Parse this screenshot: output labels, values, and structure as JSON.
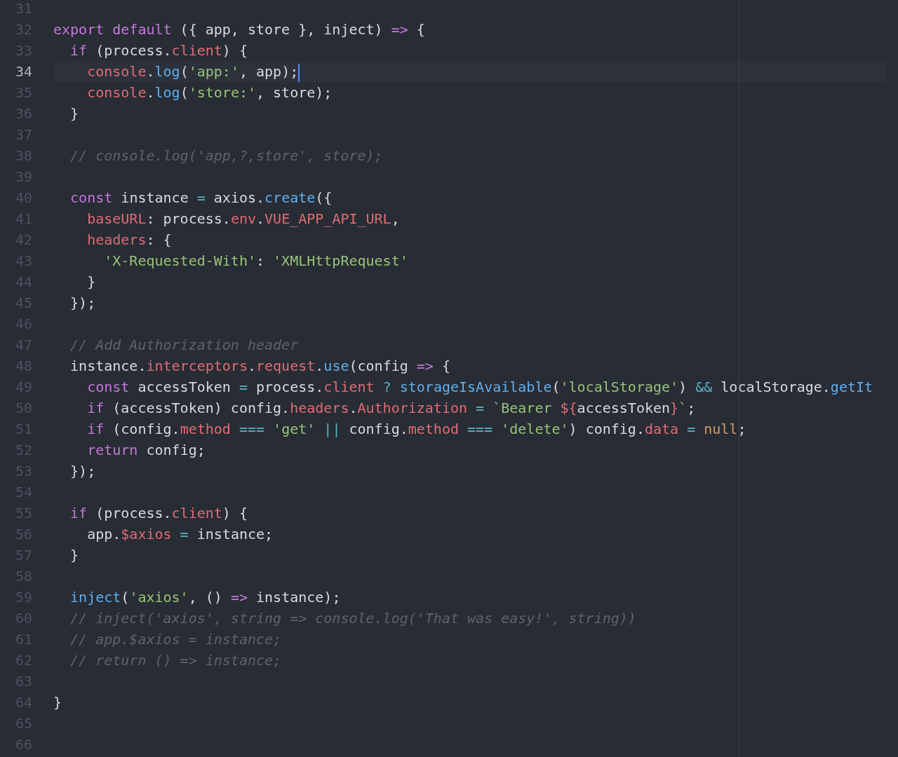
{
  "editor": {
    "lines": [
      {
        "number": "31",
        "active": false
      },
      {
        "number": "32",
        "active": false,
        "tokens": [
          {
            "kind": "keyword",
            "text": "export default"
          },
          {
            "kind": "plain",
            "text": " ({ app, store }, inject) "
          },
          {
            "kind": "keyword",
            "text": "=>"
          },
          {
            "kind": "plain",
            "text": " {"
          }
        ]
      },
      {
        "number": "33",
        "active": false,
        "tokens": [
          {
            "kind": "keyword",
            "text": "  if"
          },
          {
            "kind": "plain",
            "text": " (process."
          },
          {
            "kind": "property",
            "text": "client"
          },
          {
            "kind": "plain",
            "text": ") {"
          }
        ]
      },
      {
        "number": "34",
        "active": true,
        "tokens": [
          {
            "kind": "property",
            "text": "    console"
          },
          {
            "kind": "plain",
            "text": "."
          },
          {
            "kind": "function",
            "text": "log"
          },
          {
            "kind": "plain",
            "text": "("
          },
          {
            "kind": "string",
            "text": "'app:'"
          },
          {
            "kind": "plain",
            "text": ", app);"
          }
        ]
      },
      {
        "number": "35",
        "active": false,
        "tokens": [
          {
            "kind": "property",
            "text": "    console"
          },
          {
            "kind": "plain",
            "text": "."
          },
          {
            "kind": "function",
            "text": "log"
          },
          {
            "kind": "plain",
            "text": "("
          },
          {
            "kind": "string",
            "text": "'store:'"
          },
          {
            "kind": "plain",
            "text": ", store);"
          }
        ]
      },
      {
        "number": "36",
        "active": false,
        "tokens": [
          {
            "kind": "plain",
            "text": "  }"
          }
        ]
      },
      {
        "number": "37",
        "active": false
      },
      {
        "number": "38",
        "active": false,
        "tokens": [
          {
            "kind": "comment",
            "text": "  // console.log('app,?,store', store);"
          }
        ]
      },
      {
        "number": "39",
        "active": false
      },
      {
        "number": "40",
        "active": false,
        "tokens": [
          {
            "kind": "keyword",
            "text": "  const"
          },
          {
            "kind": "plain",
            "text": " instance "
          },
          {
            "kind": "operator",
            "text": "="
          },
          {
            "kind": "plain",
            "text": " axios."
          },
          {
            "kind": "function",
            "text": "create"
          },
          {
            "kind": "plain",
            "text": "({"
          }
        ]
      },
      {
        "number": "41",
        "active": false,
        "tokens": [
          {
            "kind": "property",
            "text": "    baseURL"
          },
          {
            "kind": "plain",
            "text": ": process."
          },
          {
            "kind": "property",
            "text": "env"
          },
          {
            "kind": "plain",
            "text": "."
          },
          {
            "kind": "property",
            "text": "VUE_APP_API_URL"
          },
          {
            "kind": "plain",
            "text": ","
          }
        ]
      },
      {
        "number": "42",
        "active": false,
        "tokens": [
          {
            "kind": "property",
            "text": "    headers"
          },
          {
            "kind": "plain",
            "text": ": {"
          }
        ]
      },
      {
        "number": "43",
        "active": false,
        "tokens": [
          {
            "kind": "string",
            "text": "      'X-Requested-With'"
          },
          {
            "kind": "plain",
            "text": ": "
          },
          {
            "kind": "string",
            "text": "'XMLHttpRequest'"
          }
        ]
      },
      {
        "number": "44",
        "active": false,
        "tokens": [
          {
            "kind": "plain",
            "text": "    }"
          }
        ]
      },
      {
        "number": "45",
        "active": false,
        "tokens": [
          {
            "kind": "plain",
            "text": "  });"
          }
        ]
      },
      {
        "number": "46",
        "active": false
      },
      {
        "number": "47",
        "active": false,
        "tokens": [
          {
            "kind": "comment",
            "text": "  // Add Authorization header"
          }
        ]
      },
      {
        "number": "48",
        "active": false,
        "tokens": [
          {
            "kind": "plain",
            "text": "  instance."
          },
          {
            "kind": "property",
            "text": "interceptors"
          },
          {
            "kind": "plain",
            "text": "."
          },
          {
            "kind": "property",
            "text": "request"
          },
          {
            "kind": "plain",
            "text": "."
          },
          {
            "kind": "function",
            "text": "use"
          },
          {
            "kind": "plain",
            "text": "(config "
          },
          {
            "kind": "keyword",
            "text": "=>"
          },
          {
            "kind": "plain",
            "text": " {"
          }
        ]
      },
      {
        "number": "49",
        "active": false,
        "tokens": [
          {
            "kind": "keyword",
            "text": "    const"
          },
          {
            "kind": "plain",
            "text": " accessToken "
          },
          {
            "kind": "operator",
            "text": "="
          },
          {
            "kind": "plain",
            "text": " process."
          },
          {
            "kind": "property",
            "text": "client"
          },
          {
            "kind": "operator",
            "text": " ?"
          },
          {
            "kind": "function",
            "text": " storageIsAvailable"
          },
          {
            "kind": "plain",
            "text": "("
          },
          {
            "kind": "string",
            "text": "'localStorage'"
          },
          {
            "kind": "plain",
            "text": ") "
          },
          {
            "kind": "operator",
            "text": "&&"
          },
          {
            "kind": "plain",
            "text": " localStorage."
          },
          {
            "kind": "function",
            "text": "getIt"
          }
        ]
      },
      {
        "number": "50",
        "active": false,
        "tokens": [
          {
            "kind": "keyword",
            "text": "    if"
          },
          {
            "kind": "plain",
            "text": " (accessToken) config."
          },
          {
            "kind": "property",
            "text": "headers"
          },
          {
            "kind": "plain",
            "text": "."
          },
          {
            "kind": "property",
            "text": "Authorization"
          },
          {
            "kind": "operator",
            "text": " ="
          },
          {
            "kind": "string",
            "text": " `Bearer "
          },
          {
            "kind": "property",
            "text": "${"
          },
          {
            "kind": "plain",
            "text": "accessToken"
          },
          {
            "kind": "property",
            "text": "}"
          },
          {
            "kind": "string",
            "text": "`"
          },
          {
            "kind": "plain",
            "text": ";"
          }
        ]
      },
      {
        "number": "51",
        "active": false,
        "tokens": [
          {
            "kind": "keyword",
            "text": "    if"
          },
          {
            "kind": "plain",
            "text": " (config."
          },
          {
            "kind": "property",
            "text": "method"
          },
          {
            "kind": "operator",
            "text": " ==="
          },
          {
            "kind": "string",
            "text": " 'get'"
          },
          {
            "kind": "operator",
            "text": " ||"
          },
          {
            "kind": "plain",
            "text": " config."
          },
          {
            "kind": "property",
            "text": "method"
          },
          {
            "kind": "operator",
            "text": " ==="
          },
          {
            "kind": "string",
            "text": " 'delete'"
          },
          {
            "kind": "plain",
            "text": ") config."
          },
          {
            "kind": "property",
            "text": "data"
          },
          {
            "kind": "operator",
            "text": " ="
          },
          {
            "kind": "constant",
            "text": " null"
          },
          {
            "kind": "plain",
            "text": ";"
          }
        ]
      },
      {
        "number": "52",
        "active": false,
        "tokens": [
          {
            "kind": "keyword",
            "text": "    return"
          },
          {
            "kind": "plain",
            "text": " config;"
          }
        ]
      },
      {
        "number": "53",
        "active": false,
        "tokens": [
          {
            "kind": "plain",
            "text": "  });"
          }
        ]
      },
      {
        "number": "54",
        "active": false
      },
      {
        "number": "55",
        "active": false,
        "tokens": [
          {
            "kind": "keyword",
            "text": "  if"
          },
          {
            "kind": "plain",
            "text": " (process."
          },
          {
            "kind": "property",
            "text": "client"
          },
          {
            "kind": "plain",
            "text": ") {"
          }
        ]
      },
      {
        "number": "56",
        "active": false,
        "tokens": [
          {
            "kind": "plain",
            "text": "    app."
          },
          {
            "kind": "property",
            "text": "$axios"
          },
          {
            "kind": "operator",
            "text": " ="
          },
          {
            "kind": "plain",
            "text": " instance;"
          }
        ]
      },
      {
        "number": "57",
        "active": false,
        "tokens": [
          {
            "kind": "plain",
            "text": "  }"
          }
        ]
      },
      {
        "number": "58",
        "active": false
      },
      {
        "number": "59",
        "active": false,
        "tokens": [
          {
            "kind": "function",
            "text": "  inject"
          },
          {
            "kind": "plain",
            "text": "("
          },
          {
            "kind": "string",
            "text": "'axios'"
          },
          {
            "kind": "plain",
            "text": ", () "
          },
          {
            "kind": "keyword",
            "text": "=>"
          },
          {
            "kind": "plain",
            "text": " instance);"
          }
        ]
      },
      {
        "number": "60",
        "active": false,
        "tokens": [
          {
            "kind": "comment",
            "text": "  // inject('axios', string => console.log('That was easy!', string))"
          }
        ]
      },
      {
        "number": "61",
        "active": false,
        "tokens": [
          {
            "kind": "comment",
            "text": "  // app.$axios = instance;"
          }
        ]
      },
      {
        "number": "62",
        "active": false,
        "tokens": [
          {
            "kind": "comment",
            "text": "  // return () => instance;"
          }
        ]
      },
      {
        "number": "63",
        "active": false
      },
      {
        "number": "64",
        "active": false,
        "tokens": [
          {
            "kind": "plain",
            "text": "}"
          }
        ]
      },
      {
        "number": "65",
        "active": false
      },
      {
        "number": "66",
        "active": false
      }
    ]
  }
}
